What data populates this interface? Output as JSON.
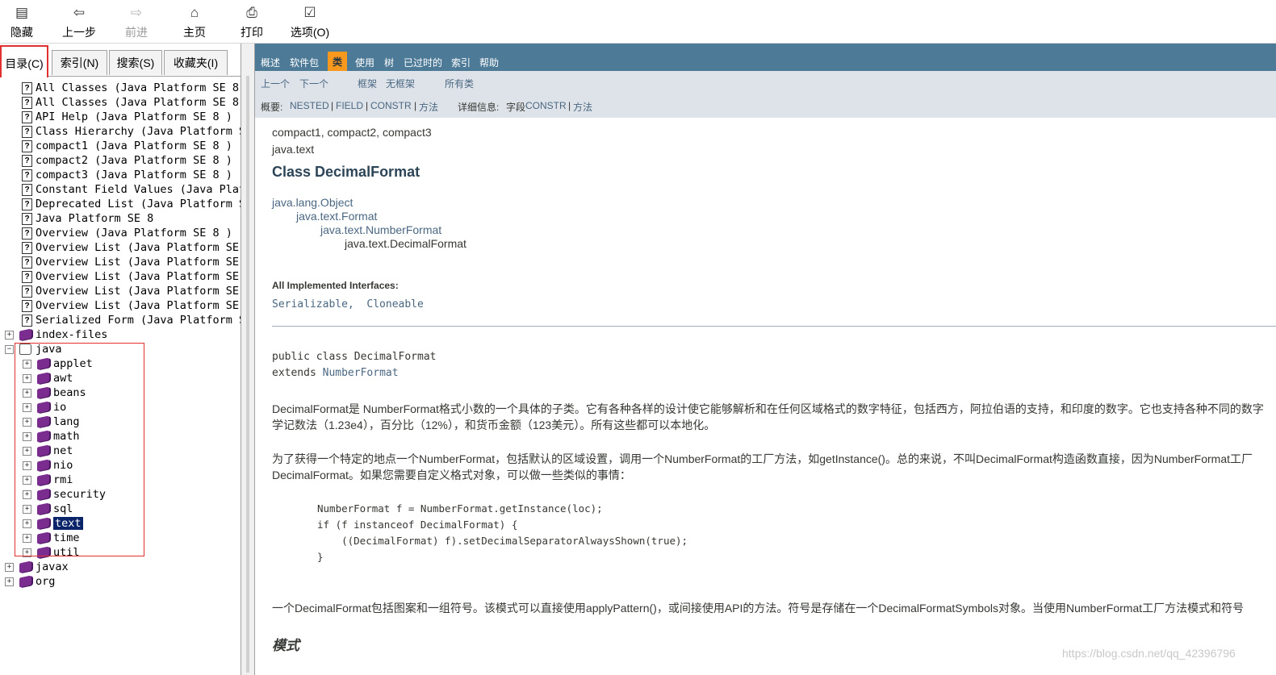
{
  "toolbar": {
    "hide": "隐藏",
    "back": "上一步",
    "forward": "前进",
    "home": "主页",
    "print": "打印",
    "options": "选项(O)"
  },
  "tabs": {
    "contents": "目录(C)",
    "index": "索引(N)",
    "search": "搜索(S)",
    "favorites": "收藏夹(I)"
  },
  "tree": {
    "pages": [
      "All Classes (Java Platform SE 8",
      "All Classes (Java Platform SE 8",
      "API Help (Java Platform SE 8 )",
      "Class Hierarchy (Java Platform S",
      "compact1 (Java Platform SE 8 )",
      "compact2 (Java Platform SE 8 )",
      "compact3 (Java Platform SE 8 )",
      "Constant Field Values (Java Plat",
      "Deprecated List (Java Platform S",
      "Java Platform SE 8",
      "Overview (Java Platform SE 8 )",
      "Overview List (Java Platform SE",
      "Overview List (Java Platform SE",
      "Overview List (Java Platform SE",
      "Overview List (Java Platform SE",
      "Overview List (Java Platform SE",
      "Serialized Form (Java Platform S"
    ],
    "index_files": "index-files",
    "java": "java",
    "java_children": [
      "applet",
      "awt",
      "beans",
      "io",
      "lang",
      "math",
      "net",
      "nio",
      "rmi",
      "security",
      "sql",
      "text",
      "time",
      "util"
    ],
    "selected": "text",
    "javax": "javax",
    "org": "org"
  },
  "navbar": {
    "items": [
      "概述",
      "软件包",
      "类",
      "使用",
      "树",
      "已过时的",
      "索引",
      "帮助"
    ],
    "active": "类"
  },
  "subnav": {
    "prev": "上一个",
    "next": "下一个",
    "frames": "框架",
    "no_frames": "无框架",
    "all_classes": "所有类",
    "summary_label": "概要:",
    "summary_nested": "NESTED",
    "summary_field": "FIELD",
    "summary_constr": "CONSTR",
    "summary_method": "方法",
    "detail_label": "详细信息:",
    "detail_field": "字段",
    "detail_constr": "CONSTR",
    "detail_method": "方法",
    "sep": "|"
  },
  "content": {
    "profiles": "compact1, compact2, compact3",
    "package": "java.text",
    "title": "Class DecimalFormat",
    "hierarchy": [
      "java.lang.Object",
      "java.text.Format",
      "java.text.NumberFormat",
      "java.text.DecimalFormat"
    ],
    "interfaces_label": "All Implemented Interfaces:",
    "interfaces": "Serializable,  Cloneable",
    "decl_1": "public class DecimalFormat",
    "decl_2_prefix": "extends ",
    "decl_2_link": "NumberFormat",
    "para1_line1": "DecimalFormat是 NumberFormat格式小数的一个具体的子类。它有各种各样的设计使它能够解析和在任何区域格式的数字特征，包括西方，阿拉伯语的支持，和印度的数字。它也支持各种不同的数字",
    "para1_line2": "学记数法（1.23e4），百分比（12%），和货币金额（123美元）。所有这些都可以本地化。",
    "para2_line1": "为了获得一个特定的地点一个NumberFormat，包括默认的区域设置，调用一个NumberFormat的工厂方法，如getInstance()。总的来说，不叫DecimalFormat构造函数直接，因为NumberFormat工厂",
    "para2_line2": "DecimalFormat。如果您需要自定义格式对象，可以做一些类似的事情：",
    "code": [
      "NumberFormat f = NumberFormat.getInstance(loc);",
      "if (f instanceof DecimalFormat) {",
      "    ((DecimalFormat) f).setDecimalSeparatorAlwaysShown(true);",
      "}"
    ],
    "para3": "一个DecimalFormat包括图案和一组符号。该模式可以直接使用applyPattern()，或间接使用API的方法。符号是存储在一个DecimalFormatSymbols对象。当使用NumberFormat工厂方法模式和符号",
    "section": "模式"
  },
  "watermark": "https://blog.csdn.net/qq_42396796"
}
